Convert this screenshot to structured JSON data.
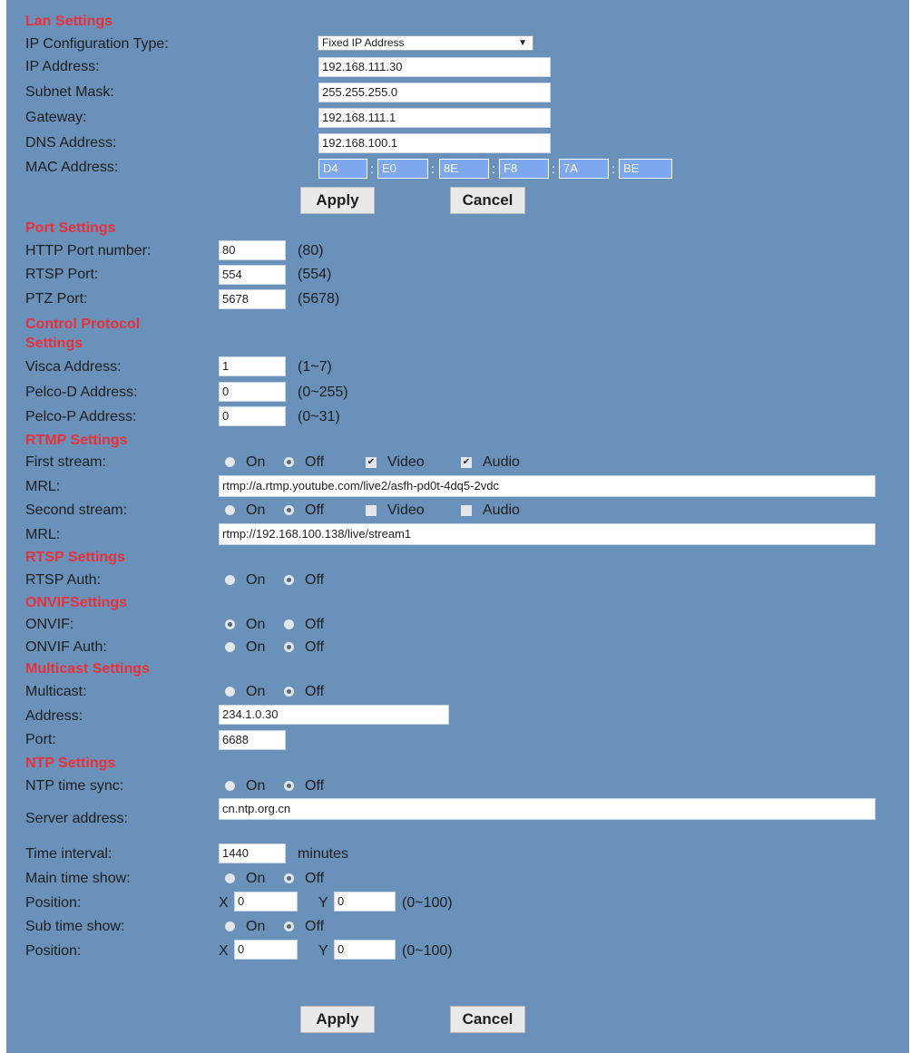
{
  "lan": {
    "heading": "Lan Settings",
    "ip_type_label": "IP Configuration Type:",
    "ip_type_value": "Fixed IP Address",
    "ip_label": "IP Address:",
    "ip_value": "192.168.111.30",
    "mask_label": "Subnet Mask:",
    "mask_value": "255.255.255.0",
    "gateway_label": "Gateway:",
    "gateway_value": "192.168.111.1",
    "dns_label": "DNS Address:",
    "dns_value": "192.168.100.1",
    "mac_label": "MAC Address:",
    "mac": [
      "D4",
      "E0",
      "8E",
      "F8",
      "7A",
      "BE"
    ],
    "mac_sep": ":",
    "apply": "Apply",
    "cancel": "Cancel"
  },
  "port": {
    "heading": "Port Settings",
    "http_label": "HTTP Port number:",
    "http_value": "80",
    "http_default": "(80)",
    "rtsp_label": "RTSP Port:",
    "rtsp_value": "554",
    "rtsp_default": "(554)",
    "ptz_label": "PTZ Port:",
    "ptz_value": "5678",
    "ptz_default": "(5678)"
  },
  "control": {
    "heading_line1": "Control Protocol",
    "heading_line2": "Settings",
    "visca_label": "Visca Address:",
    "visca_value": "1",
    "visca_range": "(1~7)",
    "pelcod_label": "Pelco-D Address:",
    "pelcod_value": "0",
    "pelcod_range": "(0~255)",
    "pelcop_label": "Pelco-P Address:",
    "pelcop_value": "0",
    "pelcop_range": "(0~31)"
  },
  "rtmp": {
    "heading": "RTMP Settings",
    "first_label": "First stream:",
    "first_on": "On",
    "first_off": "Off",
    "first_video": "Video",
    "first_audio": "Audio",
    "mrl1_label": "MRL:",
    "mrl1_value": "rtmp://a.rtmp.youtube.com/live2/asfh-pd0t-4dq5-2vdc",
    "second_label": "Second stream:",
    "second_on": "On",
    "second_off": "Off",
    "second_video": "Video",
    "second_audio": "Audio",
    "mrl2_label": "MRL:",
    "mrl2_value": "rtmp://192.168.100.138/live/stream1"
  },
  "rtsp": {
    "heading": "RTSP Settings",
    "auth_label": "RTSP Auth:",
    "on": "On",
    "off": "Off"
  },
  "onvif": {
    "heading": "ONVIFSettings",
    "onvif_label": "ONVIF:",
    "onvif_on": "On",
    "onvif_off": "Off",
    "auth_label": "ONVIF Auth:",
    "auth_on": "On",
    "auth_off": "Off"
  },
  "multicast": {
    "heading": "Multicast Settings",
    "multicast_label": "Multicast:",
    "on": "On",
    "off": "Off",
    "address_label": "Address:",
    "address_value": "234.1.0.30",
    "port_label": "Port:",
    "port_value": "6688"
  },
  "ntp": {
    "heading": "NTP Settings",
    "sync_label": "NTP time sync:",
    "sync_on": "On",
    "sync_off": "Off",
    "server_label": "Server address:",
    "server_value": "cn.ntp.org.cn",
    "interval_label": "Time interval:",
    "interval_value": "1440",
    "interval_unit": "minutes",
    "main_label": "Main time show:",
    "main_on": "On",
    "main_off": "Off",
    "pos1_label": "Position:",
    "pos1_x_label": "X",
    "pos1_x_value": "0",
    "pos1_y_label": "Y",
    "pos1_y_value": "0",
    "pos1_range": "(0~100)",
    "sub_label": "Sub time show:",
    "sub_on": "On",
    "sub_off": "Off",
    "pos2_label": "Position:",
    "pos2_x_label": "X",
    "pos2_x_value": "0",
    "pos2_y_label": "Y",
    "pos2_y_value": "0",
    "pos2_range": "(0~100)"
  },
  "footer": {
    "apply": "Apply",
    "cancel": "Cancel"
  },
  "colors": {
    "panel_background": "#6a91b9",
    "heading": "#e8313a",
    "mac_field": "#7ea8ee"
  }
}
